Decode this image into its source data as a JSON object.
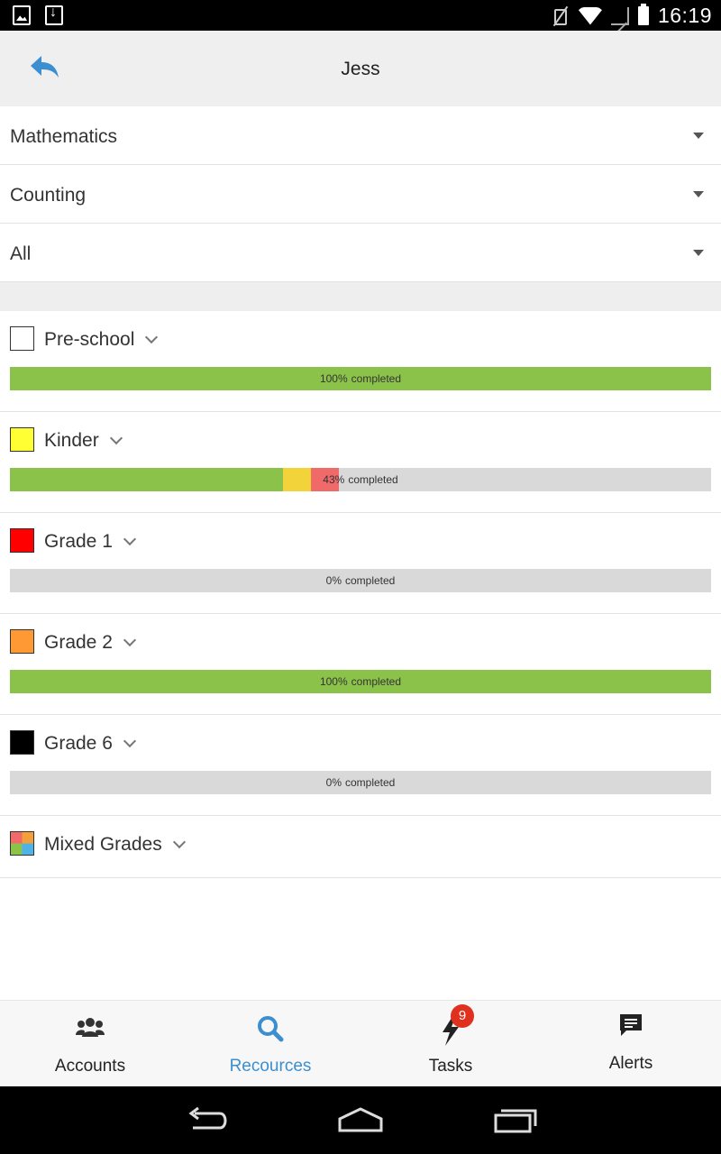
{
  "status_bar": {
    "time": "16:19"
  },
  "header": {
    "title": "Jess",
    "back_icon": "reply-arrow-icon"
  },
  "filters": [
    {
      "label": "Mathematics"
    },
    {
      "label": "Counting"
    },
    {
      "label": "All"
    }
  ],
  "grades": [
    {
      "label": "Pre-school",
      "swatch": "#ffffff",
      "percent": "100%",
      "completed_label": "completed",
      "segments": [
        {
          "color": "#8bc34a",
          "fraction": 1.0
        }
      ]
    },
    {
      "label": "Kinder",
      "swatch": "#ffff33",
      "percent": "43%",
      "completed_label": "completed",
      "segments": [
        {
          "color": "#8bc34a",
          "fraction": 0.389
        },
        {
          "color": "#f2d43a",
          "fraction": 0.04
        },
        {
          "color": "#f06a6a",
          "fraction": 0.04
        }
      ]
    },
    {
      "label": "Grade 1",
      "swatch": "#ff0000",
      "percent": "0%",
      "completed_label": "completed",
      "segments": []
    },
    {
      "label": "Grade 2",
      "swatch": "#ff9933",
      "percent": "100%",
      "completed_label": "completed",
      "segments": [
        {
          "color": "#8bc34a",
          "fraction": 1.0
        }
      ]
    },
    {
      "label": "Grade 6",
      "swatch": "#000000",
      "percent": "0%",
      "completed_label": "completed",
      "segments": []
    },
    {
      "label": "Mixed Grades",
      "swatch": "multicolor"
    }
  ],
  "tabs": [
    {
      "label": "Accounts",
      "icon": "people-icon",
      "active": false
    },
    {
      "label": "Recources",
      "icon": "search-icon",
      "active": true
    },
    {
      "label": "Tasks",
      "icon": "lightning-icon",
      "active": false,
      "badge": "9"
    },
    {
      "label": "Alerts",
      "icon": "chat-bubble-icon",
      "active": false
    }
  ],
  "colors": {
    "accent": "#3b8fd1",
    "progress_green": "#8bc34a",
    "badge_red": "#e0301e"
  }
}
